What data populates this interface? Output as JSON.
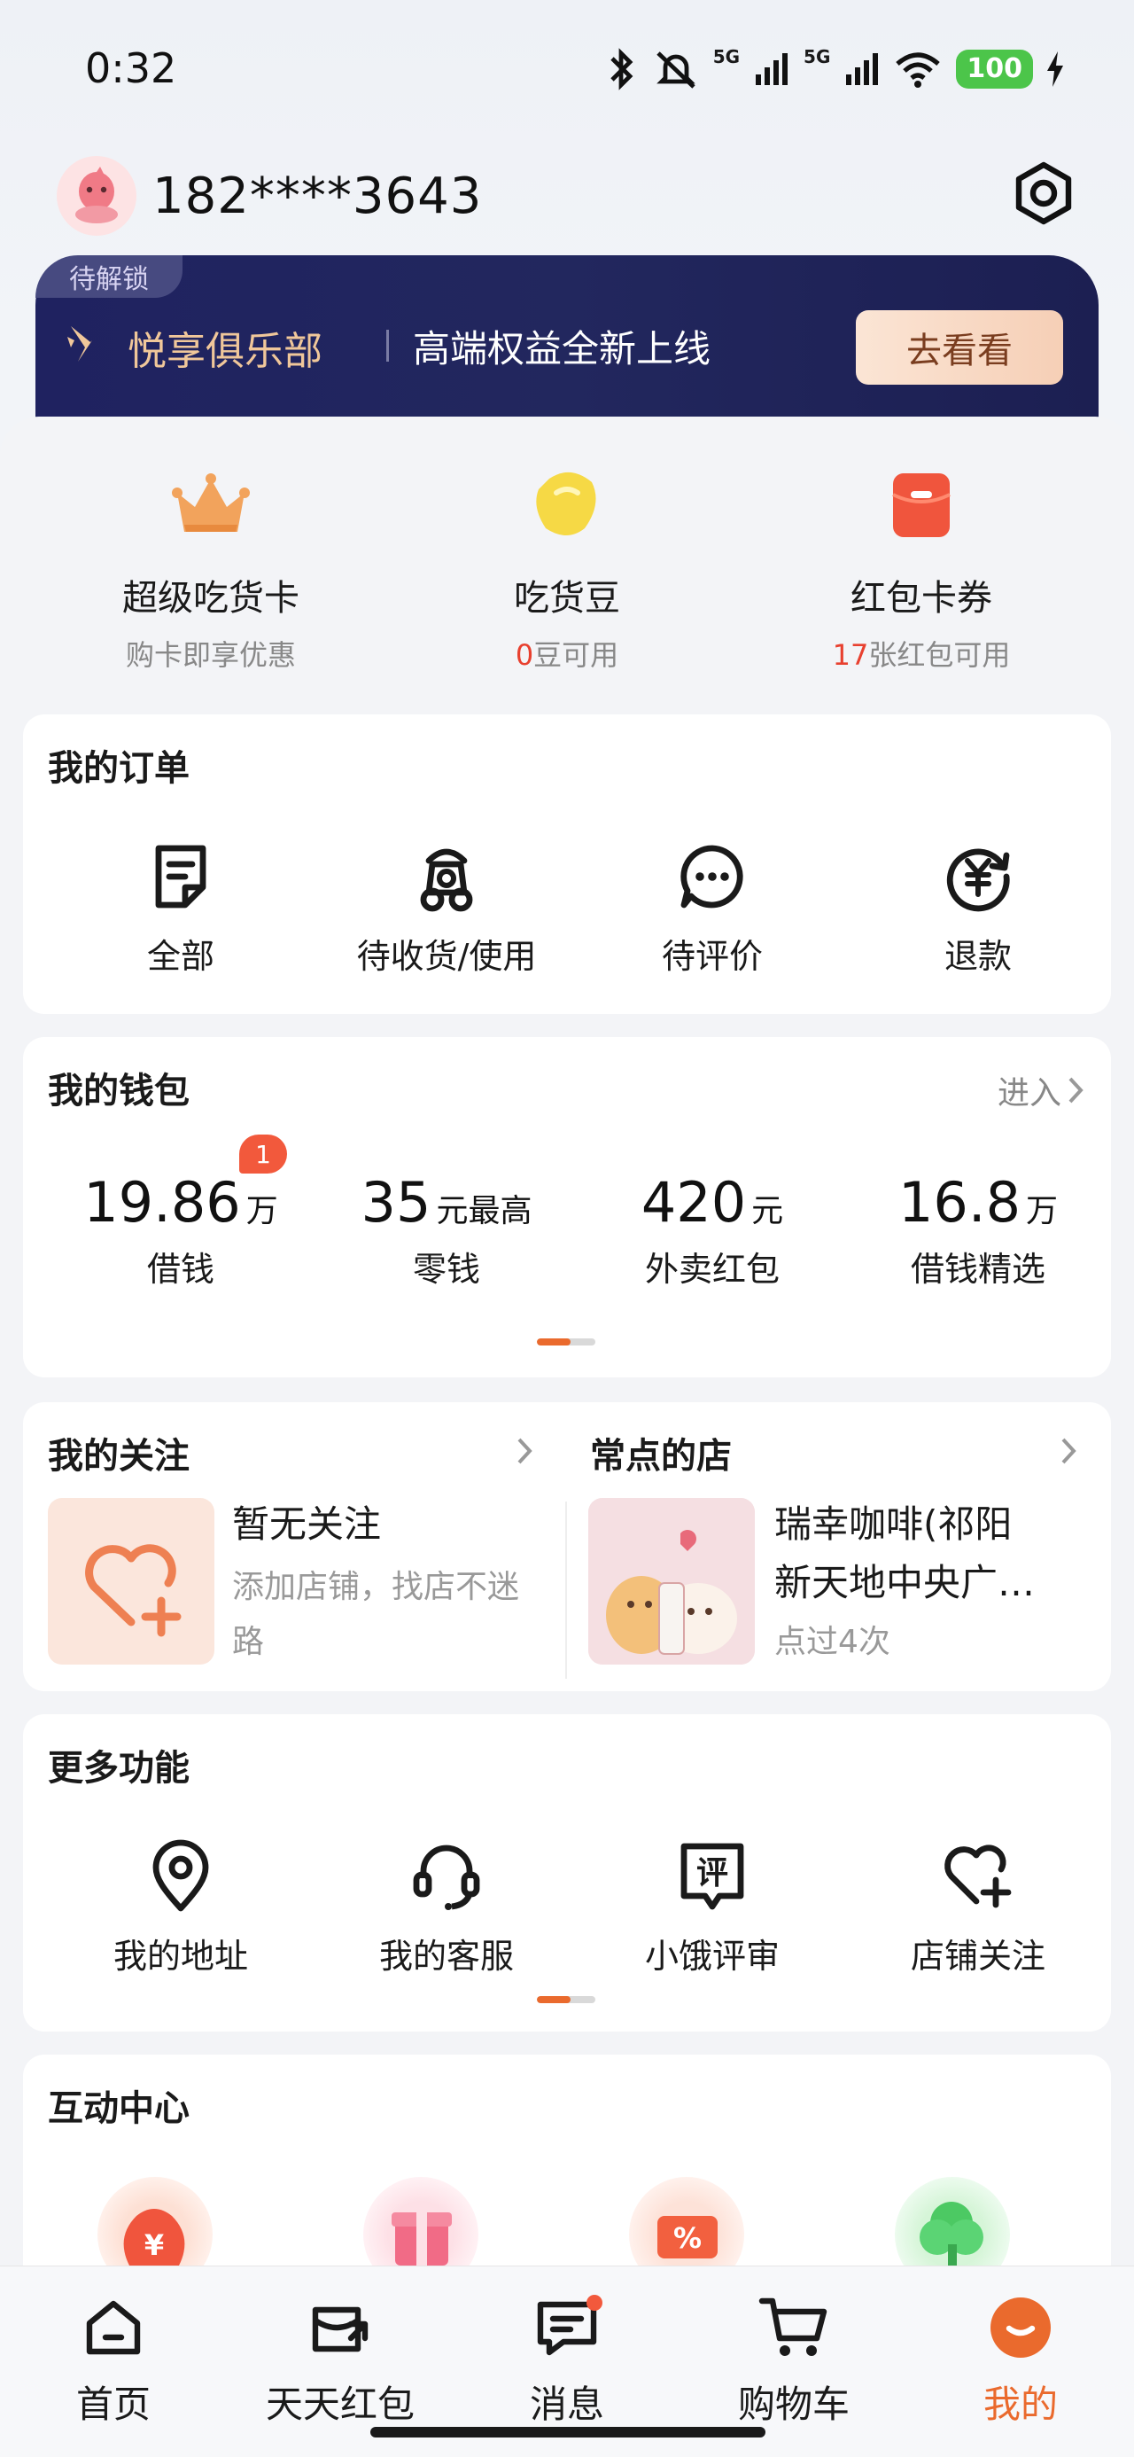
{
  "status_bar": {
    "time": "0:32",
    "battery": "100",
    "signal_1": "5G",
    "signal_2": "5G"
  },
  "profile": {
    "phone": "182****3643"
  },
  "club": {
    "tag": "待解锁",
    "name": "悦享俱乐部",
    "desc": "高端权益全新上线",
    "button": "去看看"
  },
  "assets": [
    {
      "title": "超级吃货卡",
      "sub_prefix": "",
      "sub_num": "",
      "sub_text": "购卡即享优惠",
      "icon": "crown-icon"
    },
    {
      "title": "吃货豆",
      "sub_prefix": "",
      "sub_num": "0",
      "sub_text": "豆可用",
      "icon": "bean-icon"
    },
    {
      "title": "红包卡券",
      "sub_prefix": "",
      "sub_num": "17",
      "sub_text": "张红包可用",
      "icon": "red-packet-icon"
    }
  ],
  "orders": {
    "title": "我的订单",
    "items": [
      {
        "label": "全部",
        "icon": "order-list-icon"
      },
      {
        "label": "待收货/使用",
        "icon": "scooter-icon"
      },
      {
        "label": "待评价",
        "icon": "comment-icon"
      },
      {
        "label": "退款",
        "icon": "refund-icon"
      }
    ]
  },
  "wallet": {
    "title": "我的钱包",
    "link": "进入",
    "badge": "1",
    "items": [
      {
        "value": "19.86",
        "unit": "万",
        "label": "借钱"
      },
      {
        "value": "35",
        "unit": "元最高",
        "label": "零钱"
      },
      {
        "value": "420",
        "unit": "元",
        "label": "外卖红包"
      },
      {
        "value": "16.8",
        "unit": "万",
        "label": "借钱精选"
      }
    ]
  },
  "follow": {
    "title": "我的关注",
    "empty_title": "暂无关注",
    "empty_sub_1": "添加店铺，找店不迷",
    "empty_sub_2": "路"
  },
  "frequent": {
    "title": "常点的店",
    "store_name_1": "瑞幸咖啡(祁阳",
    "store_name_2": "新天地中央广…",
    "visits": "点过4次"
  },
  "more": {
    "title": "更多功能",
    "items": [
      {
        "label": "我的地址",
        "icon": "location-icon"
      },
      {
        "label": "我的客服",
        "icon": "headset-icon"
      },
      {
        "label": "小饿评审",
        "icon": "review-icon"
      },
      {
        "label": "店铺关注",
        "icon": "heart-plus-icon"
      }
    ]
  },
  "interactive": {
    "title": "互动中心"
  },
  "tabs": [
    {
      "label": "首页",
      "icon": "home-icon"
    },
    {
      "label": "天天红包",
      "icon": "wallet-tab-icon"
    },
    {
      "label": "消息",
      "icon": "message-icon"
    },
    {
      "label": "购物车",
      "icon": "cart-icon"
    },
    {
      "label": "我的",
      "icon": "mine-icon"
    }
  ],
  "colors": {
    "accent": "#ea6a2d",
    "banner": "#1f2260",
    "highlight": "#e8402f"
  }
}
